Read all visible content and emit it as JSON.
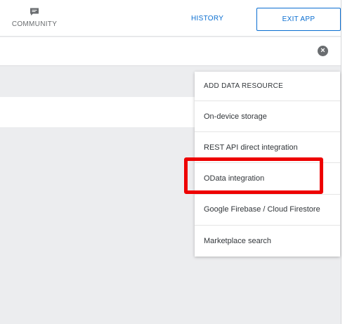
{
  "header": {
    "community_label": "COMMUNITY",
    "community_icon": "chat-bubble-icon",
    "history_label": "HISTORY",
    "exit_label": "EXIT APP"
  },
  "search": {
    "clear_icon": "clear-circle-icon"
  },
  "menu": {
    "title": "ADD DATA RESOURCE",
    "items": [
      "On-device storage",
      "REST API direct integration",
      "OData integration",
      "Google Firebase / Cloud Firestore",
      "Marketplace search"
    ],
    "highlighted_item": "OData integration"
  },
  "colors": {
    "accent": "#0a6ed1",
    "highlight": "#ee0000",
    "background": "#ecedef"
  }
}
